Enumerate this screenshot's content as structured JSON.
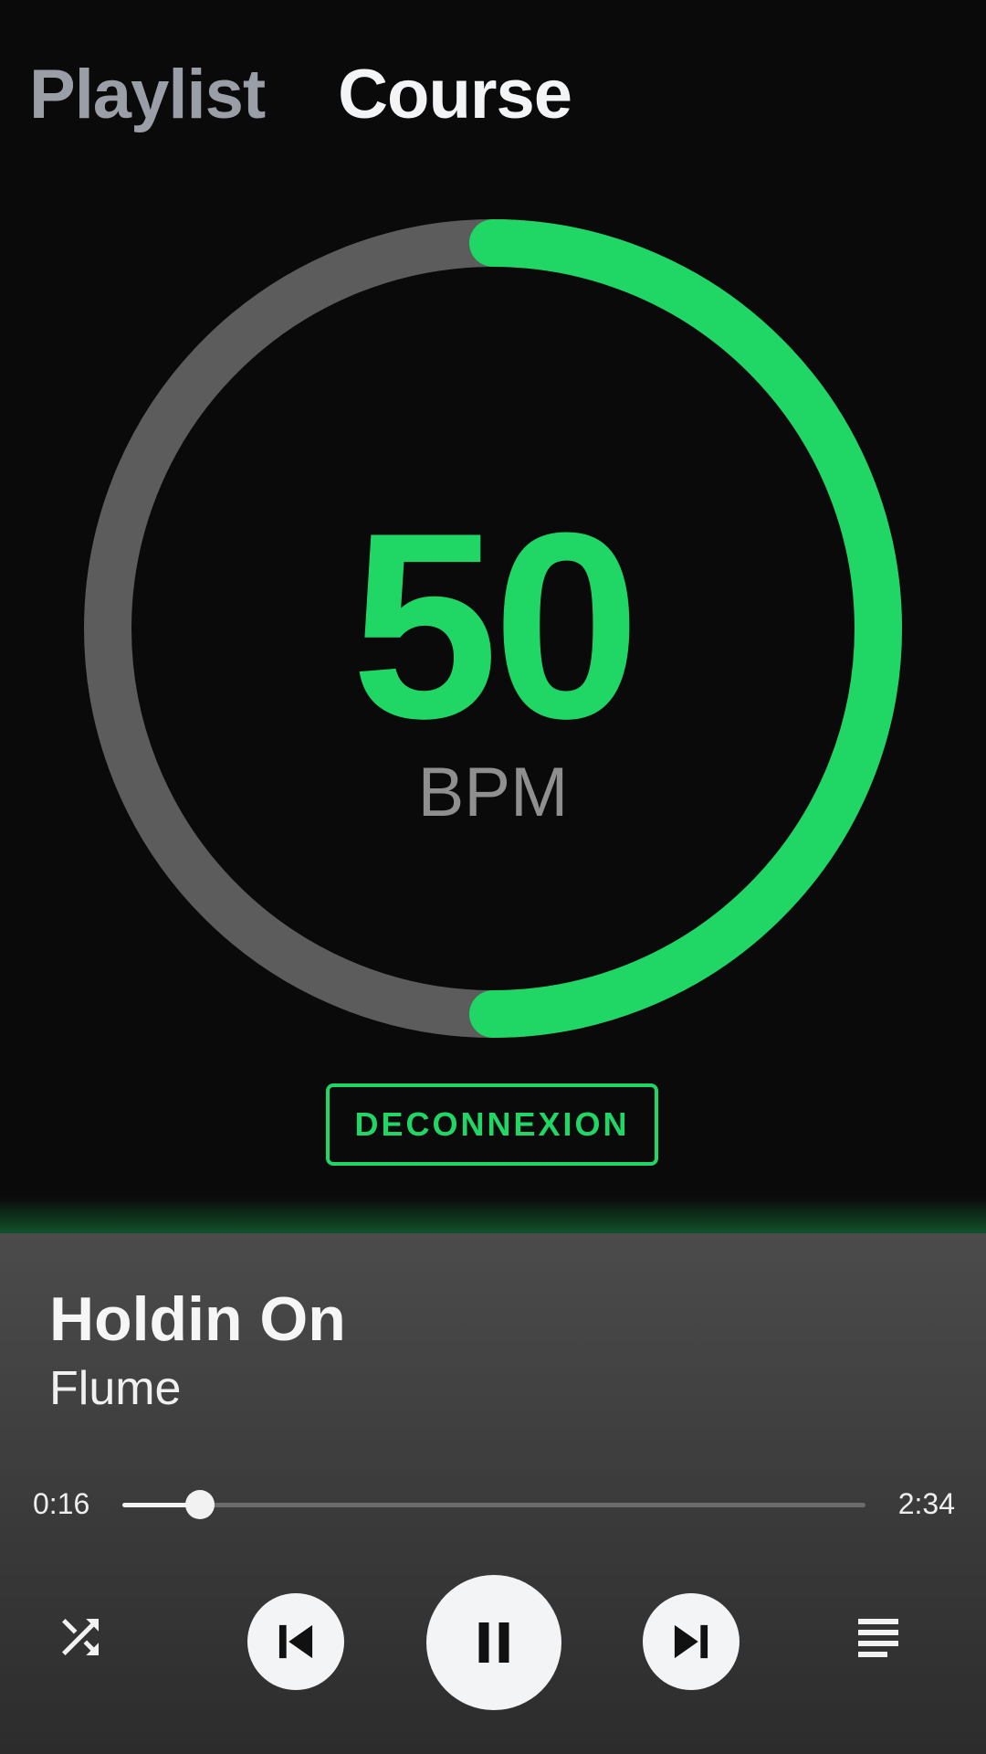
{
  "tabs": {
    "playlist": "Playlist",
    "course": "Course"
  },
  "heart_rate": {
    "value": "50",
    "unit": "BPM",
    "progress_fraction": 0.5
  },
  "disconnect_label": "DECONNEXION",
  "now_playing": {
    "title": "Holdin On",
    "artist": "Flume",
    "elapsed": "0:16",
    "duration": "2:34",
    "progress_fraction": 0.1039
  },
  "controls": {
    "icons": [
      "shuffle-icon",
      "skip-previous-icon",
      "pause-icon",
      "skip-next-icon",
      "queue-icon"
    ]
  },
  "colors": {
    "accent": "#20d664",
    "ring_track": "#5c5c5c",
    "background": "#0a0a0a",
    "player_background": "#3d3d3d",
    "button_fill": "#f3f4f6"
  }
}
